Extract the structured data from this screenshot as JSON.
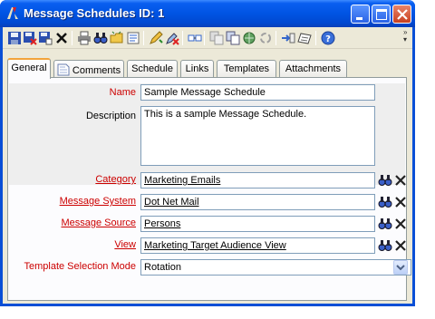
{
  "window": {
    "title": "Message Schedules ID: 1"
  },
  "tabs": [
    {
      "label": "General"
    },
    {
      "label": "Comments"
    },
    {
      "label": "Schedule"
    },
    {
      "label": "Links"
    },
    {
      "label": "Templates"
    },
    {
      "label": "Attachments"
    }
  ],
  "form": {
    "name": {
      "label": "Name",
      "value": "Sample Message Schedule"
    },
    "description": {
      "label": "Description",
      "value": "This is a sample Message Schedule."
    },
    "category": {
      "label": "Category",
      "value": "Marketing Emails"
    },
    "message_system": {
      "label": "Message System",
      "value": "Dot Net Mail"
    },
    "message_source": {
      "label": "Message Source",
      "value": "Persons"
    },
    "view": {
      "label": "View",
      "value": "Marketing Target Audience View"
    },
    "template_selection_mode": {
      "label": "Template Selection Mode",
      "value": "Rotation"
    }
  },
  "colors": {
    "required_label": "#cc0000",
    "title_bar": "#0054e3",
    "active_tab_accent": "#f2a33a"
  }
}
